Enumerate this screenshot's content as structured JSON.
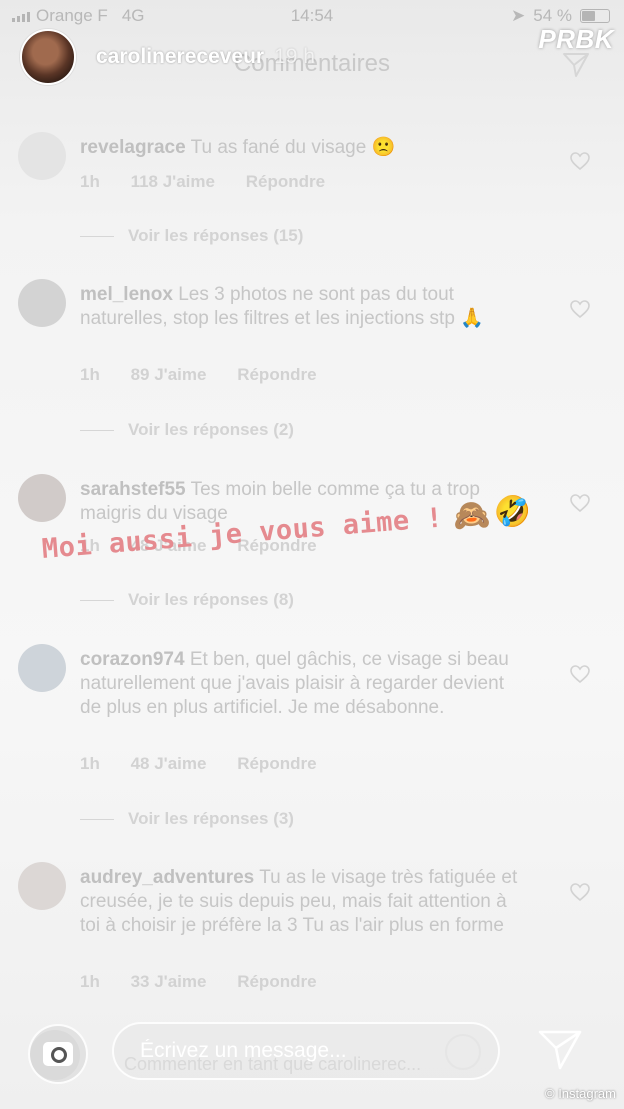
{
  "status_bar": {
    "carrier": "Orange F",
    "network": "4G",
    "time": "14:54",
    "battery": "54 %",
    "battery_fraction": 0.54
  },
  "story": {
    "username": "carolinereceveur",
    "age": "19 h",
    "screen_title": "Commentaires",
    "watermark": "PRBK"
  },
  "comments": [
    {
      "username": "revelagrace",
      "text": "Tu as fané du visage 🙁",
      "time": "1h",
      "likes": "118 J'aime",
      "reply": "Répondre",
      "view_replies": "Voir les réponses (15)"
    },
    {
      "username": "mel_lenox",
      "text": "Les 3 photos ne sont pas du tout naturelles, stop les filtres et les injections stp 🙏",
      "time": "1h",
      "likes": "89 J'aime",
      "reply": "Répondre",
      "view_replies": "Voir les réponses (2)"
    },
    {
      "username": "sarahstef55",
      "text": "Tes moin belle comme ça tu a trop maigris du visage",
      "time": "1h",
      "likes": "48 J'aime",
      "reply": "Répondre",
      "view_replies": "Voir les réponses (8)"
    },
    {
      "username": "corazon974",
      "text": "Et ben, quel gâchis, ce visage si beau naturellement que j'avais plaisir à regarder devient de plus en plus artificiel. Je me désabonne.",
      "time": "1h",
      "likes": "48 J'aime",
      "reply": "Répondre",
      "view_replies": "Voir les réponses (3)"
    },
    {
      "username": "audrey_adventures",
      "text": "Tu as le visage très fatiguée et creusée, je te suis depuis peu, mais fait attention à toi à choisir je préfère la 3 Tu as l'air plus en forme",
      "time": "1h",
      "likes": "33 J'aime",
      "reply": "Répondre"
    }
  ],
  "sticker": {
    "text": "Moi aussi je vous aime !",
    "emoji_1": "🙈",
    "emoji_2": "🤣"
  },
  "footer": {
    "message_placeholder": "Écrivez un message...",
    "ghost_comment": "Commenter en tant que carolinerec...",
    "credit": "© Instagram"
  },
  "icons": {
    "camera": "camera-icon",
    "send": "paper-plane-icon",
    "heart": "heart-outline-icon",
    "smiley": "smiley-icon"
  }
}
